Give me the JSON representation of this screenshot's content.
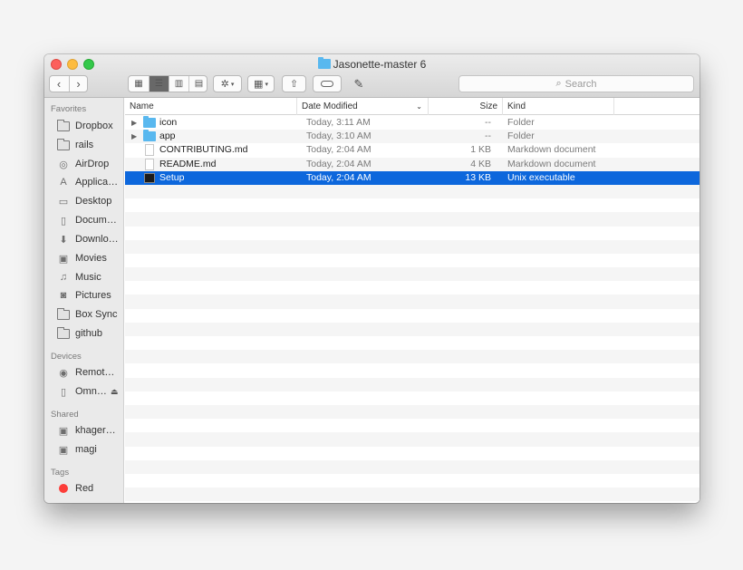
{
  "window": {
    "title": "Jasonette-master 6"
  },
  "toolbar": {
    "back_icon": "chevron-left-icon",
    "forward_icon": "chevron-right-icon",
    "view_modes": [
      "icon-view-icon",
      "list-view-icon",
      "column-view-icon",
      "cover-flow-icon"
    ],
    "active_view": "list",
    "search_placeholder": "Search"
  },
  "sidebar": {
    "favorites_heading": "Favorites",
    "favorites": [
      {
        "label": "Dropbox",
        "icon": "folder-icon"
      },
      {
        "label": "rails",
        "icon": "folder-icon"
      },
      {
        "label": "AirDrop",
        "icon": "airdrop-icon"
      },
      {
        "label": "Applica…",
        "icon": "applications-icon"
      },
      {
        "label": "Desktop",
        "icon": "desktop-icon"
      },
      {
        "label": "Docum…",
        "icon": "documents-icon"
      },
      {
        "label": "Downlo…",
        "icon": "downloads-icon"
      },
      {
        "label": "Movies",
        "icon": "movies-icon"
      },
      {
        "label": "Music",
        "icon": "music-icon"
      },
      {
        "label": "Pictures",
        "icon": "pictures-icon"
      },
      {
        "label": "Box Sync",
        "icon": "folder-icon"
      },
      {
        "label": "github",
        "icon": "folder-icon"
      }
    ],
    "devices_heading": "Devices",
    "devices": [
      {
        "label": "Remot…",
        "icon": "remote-disc-icon"
      },
      {
        "label": "Omn…",
        "icon": "drive-icon"
      }
    ],
    "shared_heading": "Shared",
    "shared": [
      {
        "label": "khager…",
        "icon": "computer-icon"
      },
      {
        "label": "magi",
        "icon": "computer-icon"
      }
    ],
    "tags_heading": "Tags",
    "tags": [
      {
        "label": "Red",
        "color": "#fc3d39"
      }
    ]
  },
  "columns": {
    "name": "Name",
    "date": "Date Modified",
    "size": "Size",
    "kind": "Kind"
  },
  "files": [
    {
      "name": "icon",
      "date": "Today, 3:11 AM",
      "size": "--",
      "kind": "Folder",
      "type": "folder",
      "selected": false
    },
    {
      "name": "app",
      "date": "Today, 3:10 AM",
      "size": "--",
      "kind": "Folder",
      "type": "folder",
      "selected": false
    },
    {
      "name": "CONTRIBUTING.md",
      "date": "Today, 2:04 AM",
      "size": "1 KB",
      "kind": "Markdown document",
      "type": "doc",
      "selected": false
    },
    {
      "name": "README.md",
      "date": "Today, 2:04 AM",
      "size": "4 KB",
      "kind": "Markdown document",
      "type": "doc",
      "selected": false
    },
    {
      "name": "Setup",
      "date": "Today, 2:04 AM",
      "size": "13 KB",
      "kind": "Unix executable",
      "type": "exec",
      "selected": true
    }
  ],
  "colors": {
    "selection": "#0d67dc",
    "folder": "#59b8ef",
    "tag_red": "#fc3d39"
  }
}
